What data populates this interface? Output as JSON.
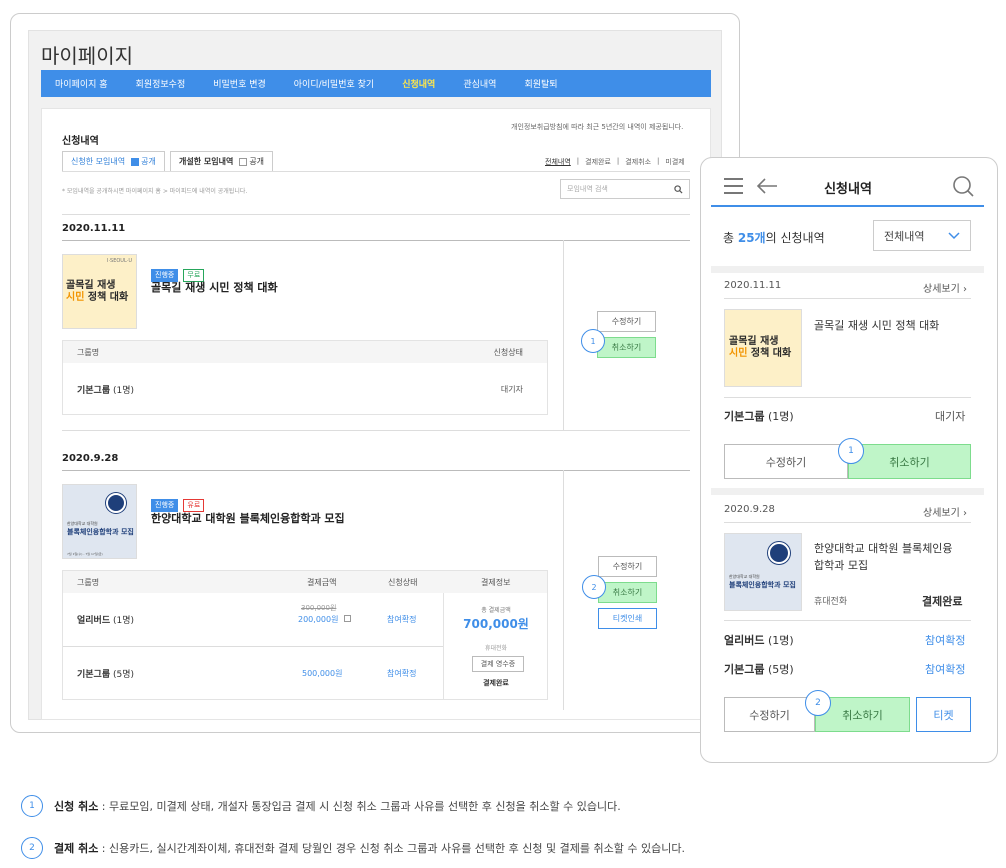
{
  "desktop": {
    "title": "마이페이지",
    "nav": [
      "마이페이지 홈",
      "회원정보수정",
      "비밀번호 변경",
      "아이디/비밀번호 찾기",
      "신청내역",
      "관심내역",
      "회원탈퇴"
    ],
    "nav_active_index": 4,
    "section_title": "신청내역",
    "notice": "개인정보취급방침에 따라 최근 5년간의 내역이 제공됩니다.",
    "tab_applied": "신청한 모임내역",
    "tab_applied_check": "공개",
    "tab_opened": "개설한 모임내역",
    "tab_opened_check": "공개",
    "filters": [
      "전체내역",
      "결제완료",
      "결제취소",
      "미결제"
    ],
    "hint": "* 모임내역을 공개하시면 마이페이지 홈 > 마이피드에 내역이 공개됩니다.",
    "search_placeholder": "모임내역 검색",
    "item1": {
      "date": "2020.11.11",
      "thumb_brand": "I·SEOUL·U",
      "thumb_line1": "골목길 재생",
      "thumb_line2a": "시민",
      "thumb_line2b": " 정책 대화",
      "badge_status": "진행중",
      "badge_price": "무료",
      "title": "골목길 재생 시민 정책 대화",
      "col_group": "그룹명",
      "col_status": "신청상태",
      "group_name": "기본그룹",
      "group_count": "(1명)",
      "status": "대기자",
      "btn_edit": "수정하기",
      "btn_cancel": "취소하기",
      "marker": "1"
    },
    "item2": {
      "date": "2020.9.28",
      "thumb_sub": "한양대학교 대학원",
      "thumb_title": "블록체인융합학과 모집",
      "thumb_date": "7월 1일(수) - 7월 17일(금)",
      "badge_status": "진행중",
      "badge_price": "유료",
      "title": "한양대학교 대학원 블록체인융합학과 모집",
      "col_group": "그룹명",
      "col_amount": "결제금액",
      "col_status": "신청상태",
      "col_payinfo": "결제정보",
      "row1_name": "얼리버드",
      "row1_count": "(1명)",
      "row1_old_price": "300,000원",
      "row1_price": "200,000원",
      "row1_status": "참여확정",
      "row2_name": "기본그룹",
      "row2_count": "(5명)",
      "row2_price": "500,000원",
      "row2_status": "참여확정",
      "total_label": "총 결제금액",
      "total_value": "700,000원",
      "pay_method": "휴대전화",
      "receipt_btn": "결제 영수증",
      "pay_status": "결제완료",
      "btn_edit": "수정하기",
      "btn_cancel": "취소하기",
      "btn_ticket": "티켓인쇄",
      "marker": "2"
    }
  },
  "mobile": {
    "title": "신청내역",
    "count_prefix": "총 ",
    "count_value": "25개",
    "count_suffix": "의 신청내역",
    "select_value": "전체내역",
    "item1": {
      "date": "2020.11.11",
      "detail": "상세보기",
      "title": "골목길 재생 시민 정책 대화",
      "group_name": "기본그룹",
      "group_count": "(1명)",
      "status": "대기자",
      "btn_edit": "수정하기",
      "btn_cancel": "취소하기",
      "marker": "1"
    },
    "item2": {
      "date": "2020.9.28",
      "detail": "상세보기",
      "title": "한양대학교 대학원 블록체인융",
      "title2": "합학과 모집",
      "pay_method": "휴대전화",
      "pay_status": "결제완료",
      "row1_name": "얼리버드",
      "row1_count": "(1명)",
      "row1_status": "참여확정",
      "row2_name": "기본그룹",
      "row2_count": "(5명)",
      "row2_status": "참여확정",
      "btn_edit": "수정하기",
      "btn_cancel": "취소하기",
      "btn_ticket": "티켓",
      "marker": "2"
    }
  },
  "notes": [
    {
      "num": "1",
      "label": "신청 취소",
      "text": " : 무료모임, 미결제 상태, 개설자 통장입금 결제 시 신청 취소 그룹과 사유를 선택한 후 신청을 취소할 수 있습니다."
    },
    {
      "num": "2",
      "label": "결제 취소",
      "text": " : 신용카드, 실시간계좌이체, 휴대전화 결제 당월인 경우 신청 취소 그룹과 사유를 선택한 후 신청 및 결제를 취소할 수 있습니다."
    }
  ],
  "colors": {
    "accent": "#3f8ee8",
    "green": "#bff5c8",
    "active_nav": "#ffe74a"
  }
}
